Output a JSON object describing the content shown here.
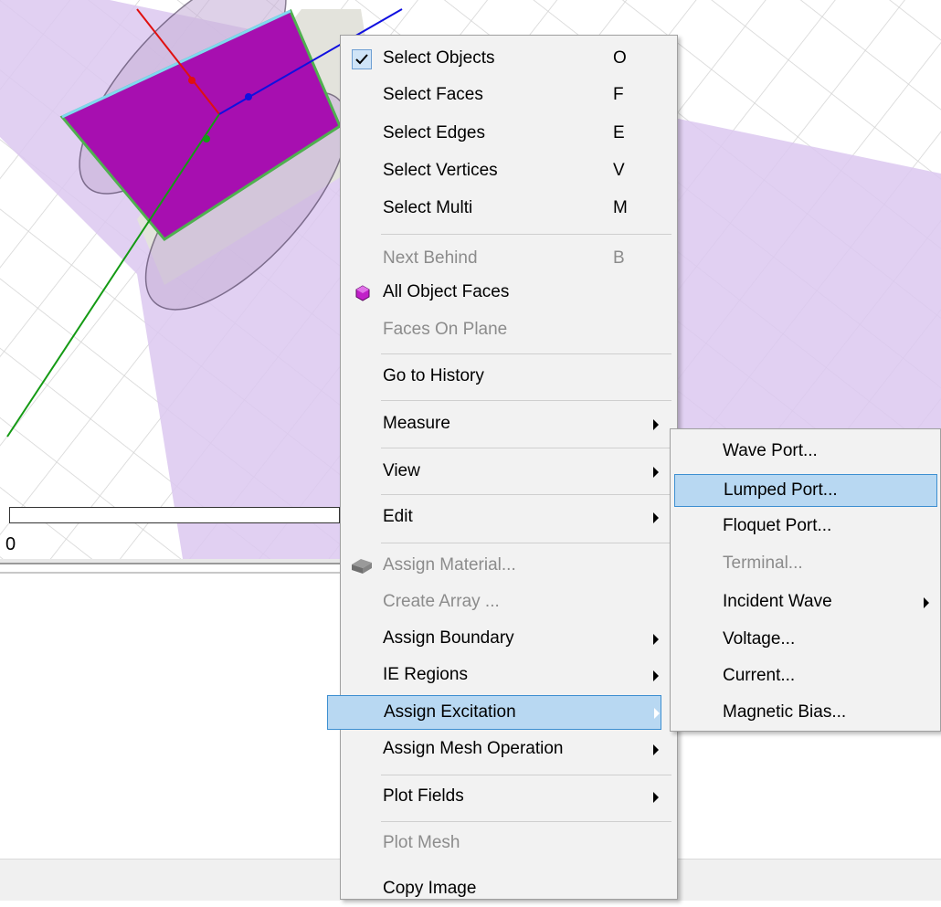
{
  "context_menu": {
    "items": [
      {
        "label": "Select Objects",
        "shortcut": "O",
        "checked": true
      },
      {
        "label": "Select Faces",
        "shortcut": "F"
      },
      {
        "label": "Select Edges",
        "shortcut": "E"
      },
      {
        "label": "Select Vertices",
        "shortcut": "V"
      },
      {
        "label": "Select Multi",
        "shortcut": "M"
      },
      {
        "label": "Next Behind",
        "shortcut": "B",
        "disabled": true
      },
      {
        "label": "All Object Faces",
        "icon": "cube-faces-icon"
      },
      {
        "label": "Faces On Plane",
        "disabled": true
      },
      {
        "label": "Go to History"
      },
      {
        "label": "Measure",
        "submenu": true
      },
      {
        "label": "View",
        "submenu": true
      },
      {
        "label": "Edit",
        "submenu": true
      },
      {
        "label": "Assign Material...",
        "disabled": true,
        "icon": "material-icon"
      },
      {
        "label": "Create Array ...",
        "disabled": true
      },
      {
        "label": "Assign Boundary",
        "submenu": true
      },
      {
        "label": "IE Regions",
        "submenu": true
      },
      {
        "label": "Assign Excitation",
        "submenu": true,
        "highlighted": true
      },
      {
        "label": "Assign Mesh Operation",
        "submenu": true
      },
      {
        "label": "Plot Fields",
        "submenu": true
      },
      {
        "label": "Plot Mesh",
        "disabled": true
      },
      {
        "label": "Copy Image"
      }
    ]
  },
  "excitation_submenu": {
    "items": [
      {
        "label": "Wave Port..."
      },
      {
        "label": "Lumped Port...",
        "highlighted": true
      },
      {
        "label": "Floquet Port..."
      },
      {
        "label": "Terminal...",
        "disabled": true
      },
      {
        "label": "Incident Wave",
        "submenu": true
      },
      {
        "label": "Voltage..."
      },
      {
        "label": "Current..."
      },
      {
        "label": "Magnetic Bias..."
      }
    ]
  },
  "ruler": {
    "zero_label": "0"
  },
  "colors": {
    "menu_bg": "#f2f2f2",
    "highlight_bg": "#b8d8f2",
    "highlight_border": "#3d8fd1",
    "disabled_text": "#8c8c8c",
    "model_face": "#a70fb0",
    "plane_fill": "#dcc8f0"
  }
}
